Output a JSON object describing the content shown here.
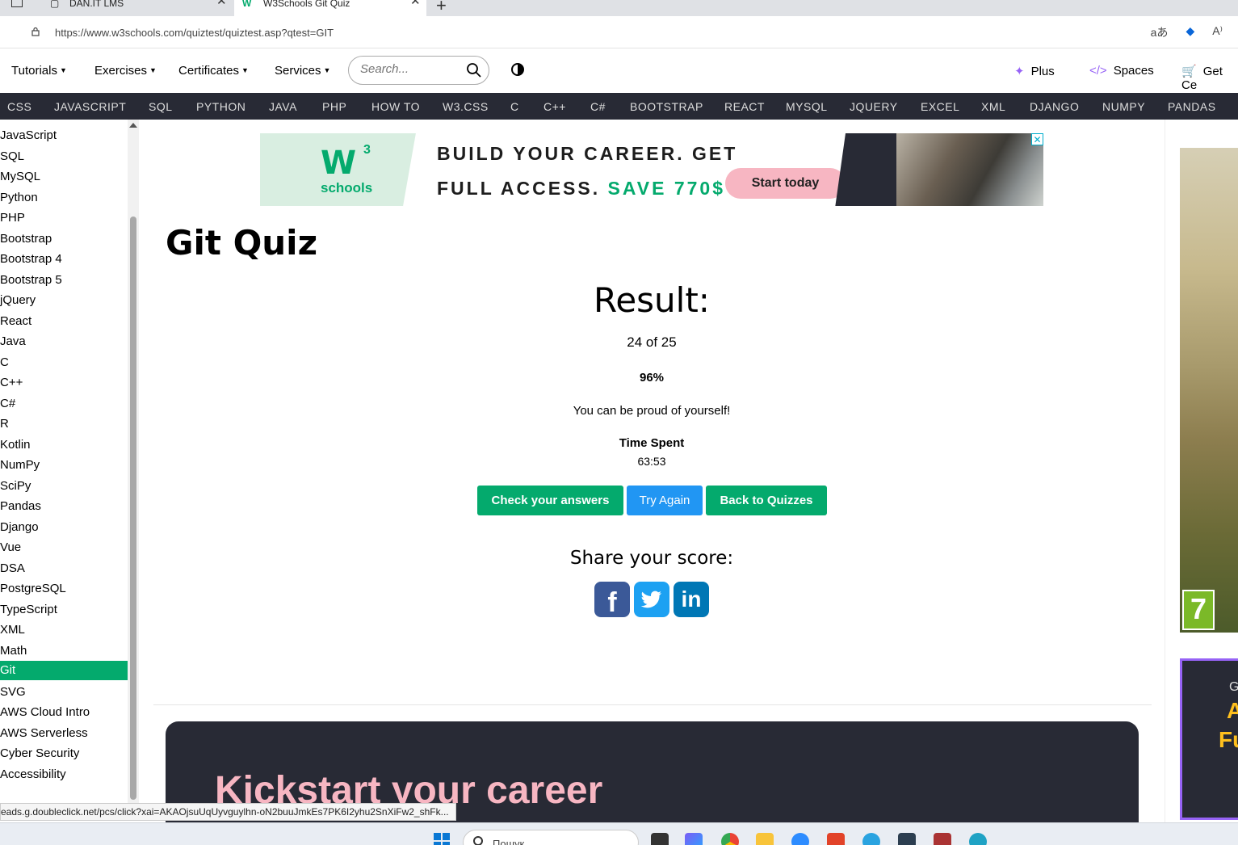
{
  "browser": {
    "tabs": [
      {
        "label": "DAN.IT LMS"
      },
      {
        "label": "W3Schools Git Quiz"
      }
    ],
    "url": "https://www.w3schools.com/quiztest/quiztest.asp?qtest=GIT",
    "close_glyph": "✕",
    "new_tab_glyph": "+",
    "icons": [
      "read-aloud-icon",
      "translate-icon",
      "shopping-tag-icon"
    ]
  },
  "topnav": {
    "items": [
      "Tutorials",
      "Exercises",
      "Certificates",
      "Services"
    ],
    "search_placeholder": "Search...",
    "right": {
      "plus": "Plus",
      "spaces": "Spaces",
      "get": "Get Ce"
    },
    "accent": "#9763f6"
  },
  "subjects": [
    "CSS",
    "JAVASCRIPT",
    "SQL",
    "PYTHON",
    "JAVA",
    "PHP",
    "HOW TO",
    "W3.CSS",
    "C",
    "C++",
    "C#",
    "BOOTSTRAP",
    "REACT",
    "MYSQL",
    "JQUERY",
    "EXCEL",
    "XML",
    "DJANGO",
    "NUMPY",
    "PANDAS"
  ],
  "sidebar": {
    "items": [
      "JavaScript",
      "SQL",
      "MySQL",
      "Python",
      "PHP",
      "Bootstrap",
      "Bootstrap 4",
      "Bootstrap 5",
      "jQuery",
      "React",
      "Java",
      "C",
      "C++",
      "C#",
      "R",
      "Kotlin",
      "NumPy",
      "SciPy",
      "Pandas",
      "Django",
      "Vue",
      "DSA",
      "PostgreSQL",
      "TypeScript",
      "XML",
      "Math",
      "Git",
      "SVG",
      "AWS Cloud Intro",
      "AWS Serverless",
      "Cyber Security",
      "Accessibility"
    ],
    "active": "Git",
    "active_color": "#04aa6d"
  },
  "ad": {
    "logo_w": "W",
    "logo_3": "3",
    "logo_text": "schools",
    "headline1": "BUILD YOUR CAREER. GET",
    "headline2": "FULL ACCESS.",
    "save": "SAVE 770$",
    "button": "Start today",
    "close": "✕"
  },
  "main": {
    "title": "Git Quiz",
    "result_title": "Result:",
    "score": "24 of 25",
    "percent": "96%",
    "message": "You can be proud of yourself!",
    "time_label": "Time Spent",
    "time_value": "63:53",
    "buttons": {
      "check": "Check your answers",
      "try": "Try Again",
      "back": "Back to Quizzes"
    },
    "share_title": "Share your score:",
    "social": [
      "f",
      "t",
      "in"
    ]
  },
  "promo": {
    "title": "Kickstart your career"
  },
  "right_ads": {
    "pegi": "7",
    "promo_l1": "G",
    "promo_l2": "A",
    "promo_l3": "Fu"
  },
  "status_url": "eads.g.doubleclick.net/pcs/click?xai=AKAOjsuUqUyvguylhn-oN2buuJmkEs7PK6I2yhu2SnXiFw2_shFk...",
  "taskbar": {
    "search_text": "Пошук"
  },
  "colors": {
    "w3_green": "#04aa6d",
    "dark": "#282a35",
    "blue_button": "#2196f3",
    "pink": "#f7b6c2"
  }
}
